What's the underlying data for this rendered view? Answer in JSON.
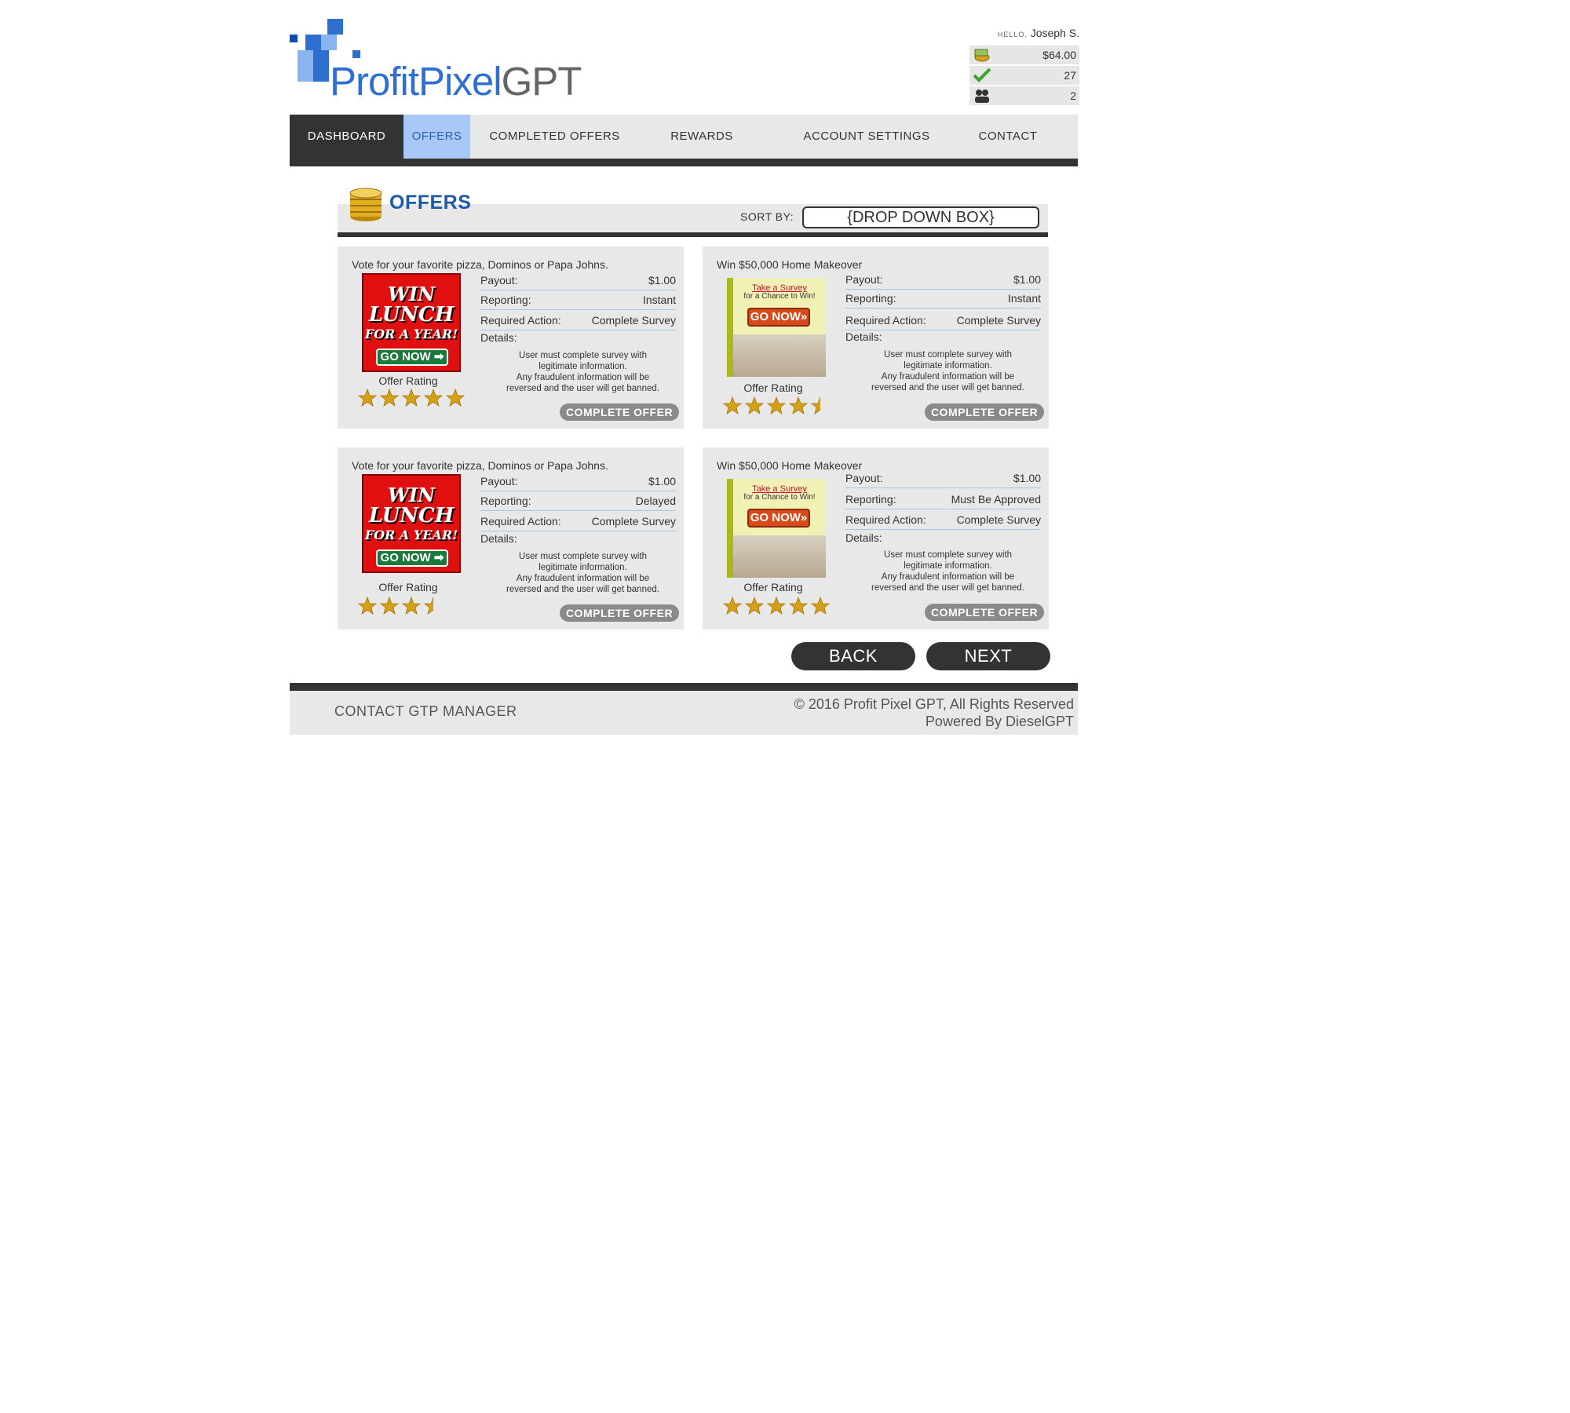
{
  "brand": {
    "name_part1": "ProfitPixel",
    "name_part2": "GPT"
  },
  "user": {
    "hello_label": "HELLO,",
    "name": "Joseph S.",
    "balance": "$64.00",
    "completed_count": "27",
    "referrals_count": "2"
  },
  "nav": {
    "items": [
      {
        "label": "DASHBOARD"
      },
      {
        "label": "OFFERS"
      },
      {
        "label": "COMPLETED OFFERS"
      },
      {
        "label": "REWARDS"
      },
      {
        "label": "ACCOUNT SETTINGS"
      },
      {
        "label": "CONTACT"
      }
    ],
    "active": "DASHBOARD",
    "highlighted": "OFFERS"
  },
  "section": {
    "title": "OFFERS",
    "sort_label": "SORT BY:",
    "sort_value": "{DROP DOWN BOX}"
  },
  "labels": {
    "payout": "Payout:",
    "reporting": "Reporting:",
    "required_action": "Required Action:",
    "details": "Details:",
    "offer_rating": "Offer Rating",
    "complete_offer": "COMPLETE OFFER"
  },
  "ads": {
    "lunch": {
      "line1": "WIN",
      "line2": "LUNCH",
      "line3": "FOR A YEAR!",
      "cta": "GO NOW ➡"
    },
    "survey": {
      "line1": "Take a Survey",
      "line2": "for a Chance to Win!",
      "cta": "GO NOW»"
    }
  },
  "offers": [
    {
      "title": "Vote for your favorite pizza, Dominos or Papa Johns.",
      "ad": "lunch",
      "payout": "$1.00",
      "reporting": "Instant",
      "required_action": "Complete Survey",
      "details": [
        "User must complete survey with",
        "legitimate information.",
        "Any fraudulent information will be",
        "reversed and the user will get banned."
      ],
      "rating": 5
    },
    {
      "title": "Win $50,000 Home Makeover",
      "ad": "survey",
      "payout": "$1.00",
      "reporting": "Instant",
      "required_action": "Complete Survey",
      "details": [
        "User must complete survey with",
        "legitimate information.",
        "Any fraudulent information will be",
        "reversed and the user will get banned."
      ],
      "rating": 4.5
    },
    {
      "title": "Vote for your favorite pizza, Dominos or Papa Johns.",
      "ad": "lunch",
      "payout": "$1.00",
      "reporting": "Delayed",
      "required_action": "Complete Survey",
      "details": [
        "User must complete survey with",
        "legitimate information.",
        "Any fraudulent information will be",
        "reversed and the user will get banned."
      ],
      "rating": 3.5
    },
    {
      "title": "Win $50,000 Home Makeover",
      "ad": "survey",
      "payout": "$1.00",
      "reporting": "Must Be Approved",
      "required_action": "Complete Survey",
      "details": [
        "User must complete survey with",
        "legitimate information.",
        "Any fraudulent information will be",
        "reversed and the user will get banned."
      ],
      "rating": 5
    }
  ],
  "pagination": {
    "back": "BACK",
    "next": "NEXT"
  },
  "footer": {
    "contact": "CONTACT GTP MANAGER",
    "copyright": "© 2016 Profit Pixel GPT, All Rights Reserved",
    "powered": "Powered By DieselGPT"
  },
  "colors": {
    "brand_blue": "#2f6fd0",
    "nav_dark": "#333333",
    "nav_highlight": "#a8c8f8",
    "title_blue": "#1f5aa8",
    "star_gold": "#d4a017",
    "panel_grey": "#e8e8e8"
  },
  "icons": {
    "balance": "money-icon",
    "completed": "checkmark-icon",
    "referrals": "users-icon",
    "section": "coins-icon"
  }
}
